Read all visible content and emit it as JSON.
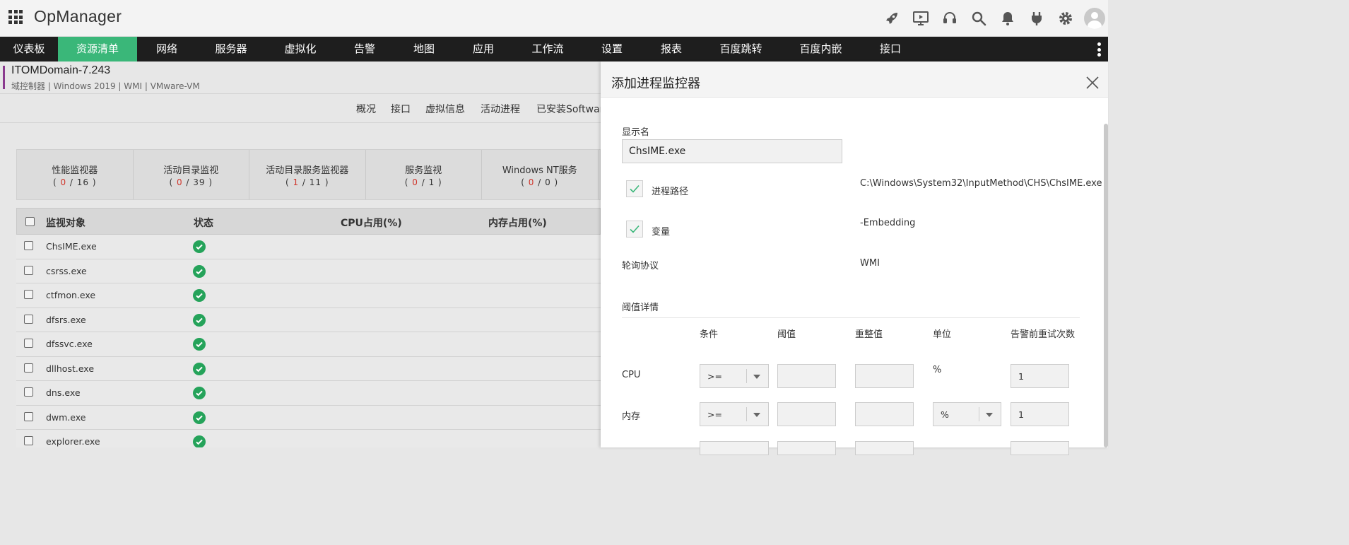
{
  "app": {
    "title": "OpManager"
  },
  "nav": {
    "items": [
      {
        "label": "仪表板",
        "width": 82,
        "active": false
      },
      {
        "label": "资源清单",
        "width": 112,
        "active": true
      },
      {
        "label": "网络",
        "width": 84,
        "active": false
      },
      {
        "label": "服务器",
        "width": 98,
        "active": false
      },
      {
        "label": "虚拟化",
        "width": 98,
        "active": false
      },
      {
        "label": "告警",
        "width": 84,
        "active": false
      },
      {
        "label": "地图",
        "width": 84,
        "active": false
      },
      {
        "label": "应用",
        "width": 84,
        "active": false
      },
      {
        "label": "工作流",
        "width": 98,
        "active": false
      },
      {
        "label": "设置",
        "width": 84,
        "active": false
      },
      {
        "label": "报表",
        "width": 84,
        "active": false
      },
      {
        "label": "百度跳转",
        "width": 113,
        "active": false
      },
      {
        "label": "百度内嵌",
        "width": 113,
        "active": false
      },
      {
        "label": "接口",
        "width": 84,
        "active": false
      }
    ]
  },
  "device": {
    "name": "ITOMDomain-7.243",
    "meta": "域控制器 | Windows 2019 | WMI | VMware-VM"
  },
  "tabs": [
    "概况",
    "接口",
    "虚拟信息",
    "活动进程",
    "已安装Softwar"
  ],
  "summary": [
    {
      "title": "性能监视器",
      "bad": "0",
      "total": "16"
    },
    {
      "title": "活动目录监视",
      "bad": "0",
      "total": "39"
    },
    {
      "title": "活动目录服务监视器",
      "bad": "1",
      "total": "11"
    },
    {
      "title": "服务监视",
      "bad": "0",
      "total": "1"
    },
    {
      "title": "Windows NT服务",
      "bad": "0",
      "total": "0"
    }
  ],
  "table": {
    "headers": [
      "监视对象",
      "状态",
      "CPU占用(%)",
      "内存占用(%)"
    ],
    "rows": [
      "ChsIME.exe",
      "csrss.exe",
      "ctfmon.exe",
      "dfsrs.exe",
      "dfssvc.exe",
      "dllhost.exe",
      "dns.exe",
      "dwm.exe",
      "explorer.exe"
    ]
  },
  "panel": {
    "title": "添加进程监控器",
    "display_name_label": "显示名",
    "display_name_value": "ChsIME.exe",
    "path_label": "进程路径",
    "path_value": "C:\\Windows\\System32\\InputMethod\\CHS\\ChsIME.exe",
    "args_label": "变量",
    "args_value": "-Embedding",
    "protocol_label": "轮询协议",
    "protocol_value": "WMI",
    "threshold_title": "阈值详情",
    "threshold_headers": [
      "条件",
      "阈值",
      "重整值",
      "单位",
      "告警前重试次数"
    ],
    "rows": [
      {
        "label": "CPU",
        "condition": ">=",
        "unit": "%",
        "retries": "1"
      },
      {
        "label": "内存",
        "condition": ">=",
        "unit": "%",
        "retries": "1"
      }
    ]
  },
  "colors": {
    "accent": "#3ab779",
    "nav_bg": "#1e1e1e",
    "status_ok": "#25a35a",
    "alert_red": "#d0352b"
  },
  "icons": [
    "apps-grid-icon",
    "rocket-icon",
    "presentation-icon",
    "headset-icon",
    "search-icon",
    "bell-icon",
    "plug-icon",
    "gear-icon",
    "user-avatar-icon",
    "more-vertical-icon",
    "close-icon",
    "check-icon",
    "checkmark-circle-icon"
  ]
}
